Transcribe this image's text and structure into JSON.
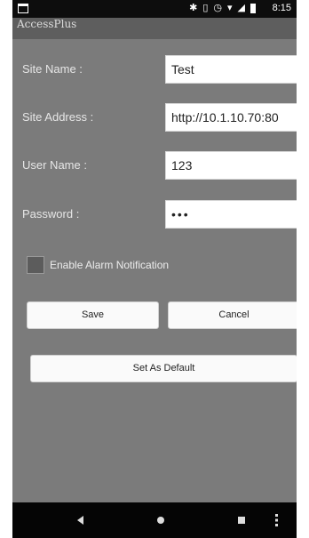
{
  "status_bar": {
    "time": "8:15",
    "icons": [
      "image-icon",
      "bluetooth-icon",
      "vibrate-icon",
      "alarm-icon",
      "wifi-icon",
      "signal-icon",
      "battery-icon"
    ]
  },
  "app": {
    "title": "AccessPlus"
  },
  "form": {
    "site_name_label": "Site Name :",
    "site_name_value": "Test",
    "site_address_label": "Site Address :",
    "site_address_value": "http://10.1.10.70:80",
    "user_name_label": "User Name :",
    "user_name_value": "123",
    "password_label": "Password :",
    "password_value": "•••",
    "alarm_label": "Enable Alarm Notification",
    "alarm_checked": false
  },
  "buttons": {
    "save": "Save",
    "cancel": "Cancel",
    "set_default": "Set As Default"
  },
  "colors": {
    "background": "#7b7b7b",
    "title_bar": "#5e5e5e",
    "status_bar": "#0d0d0d",
    "nav_bar": "#050505"
  }
}
